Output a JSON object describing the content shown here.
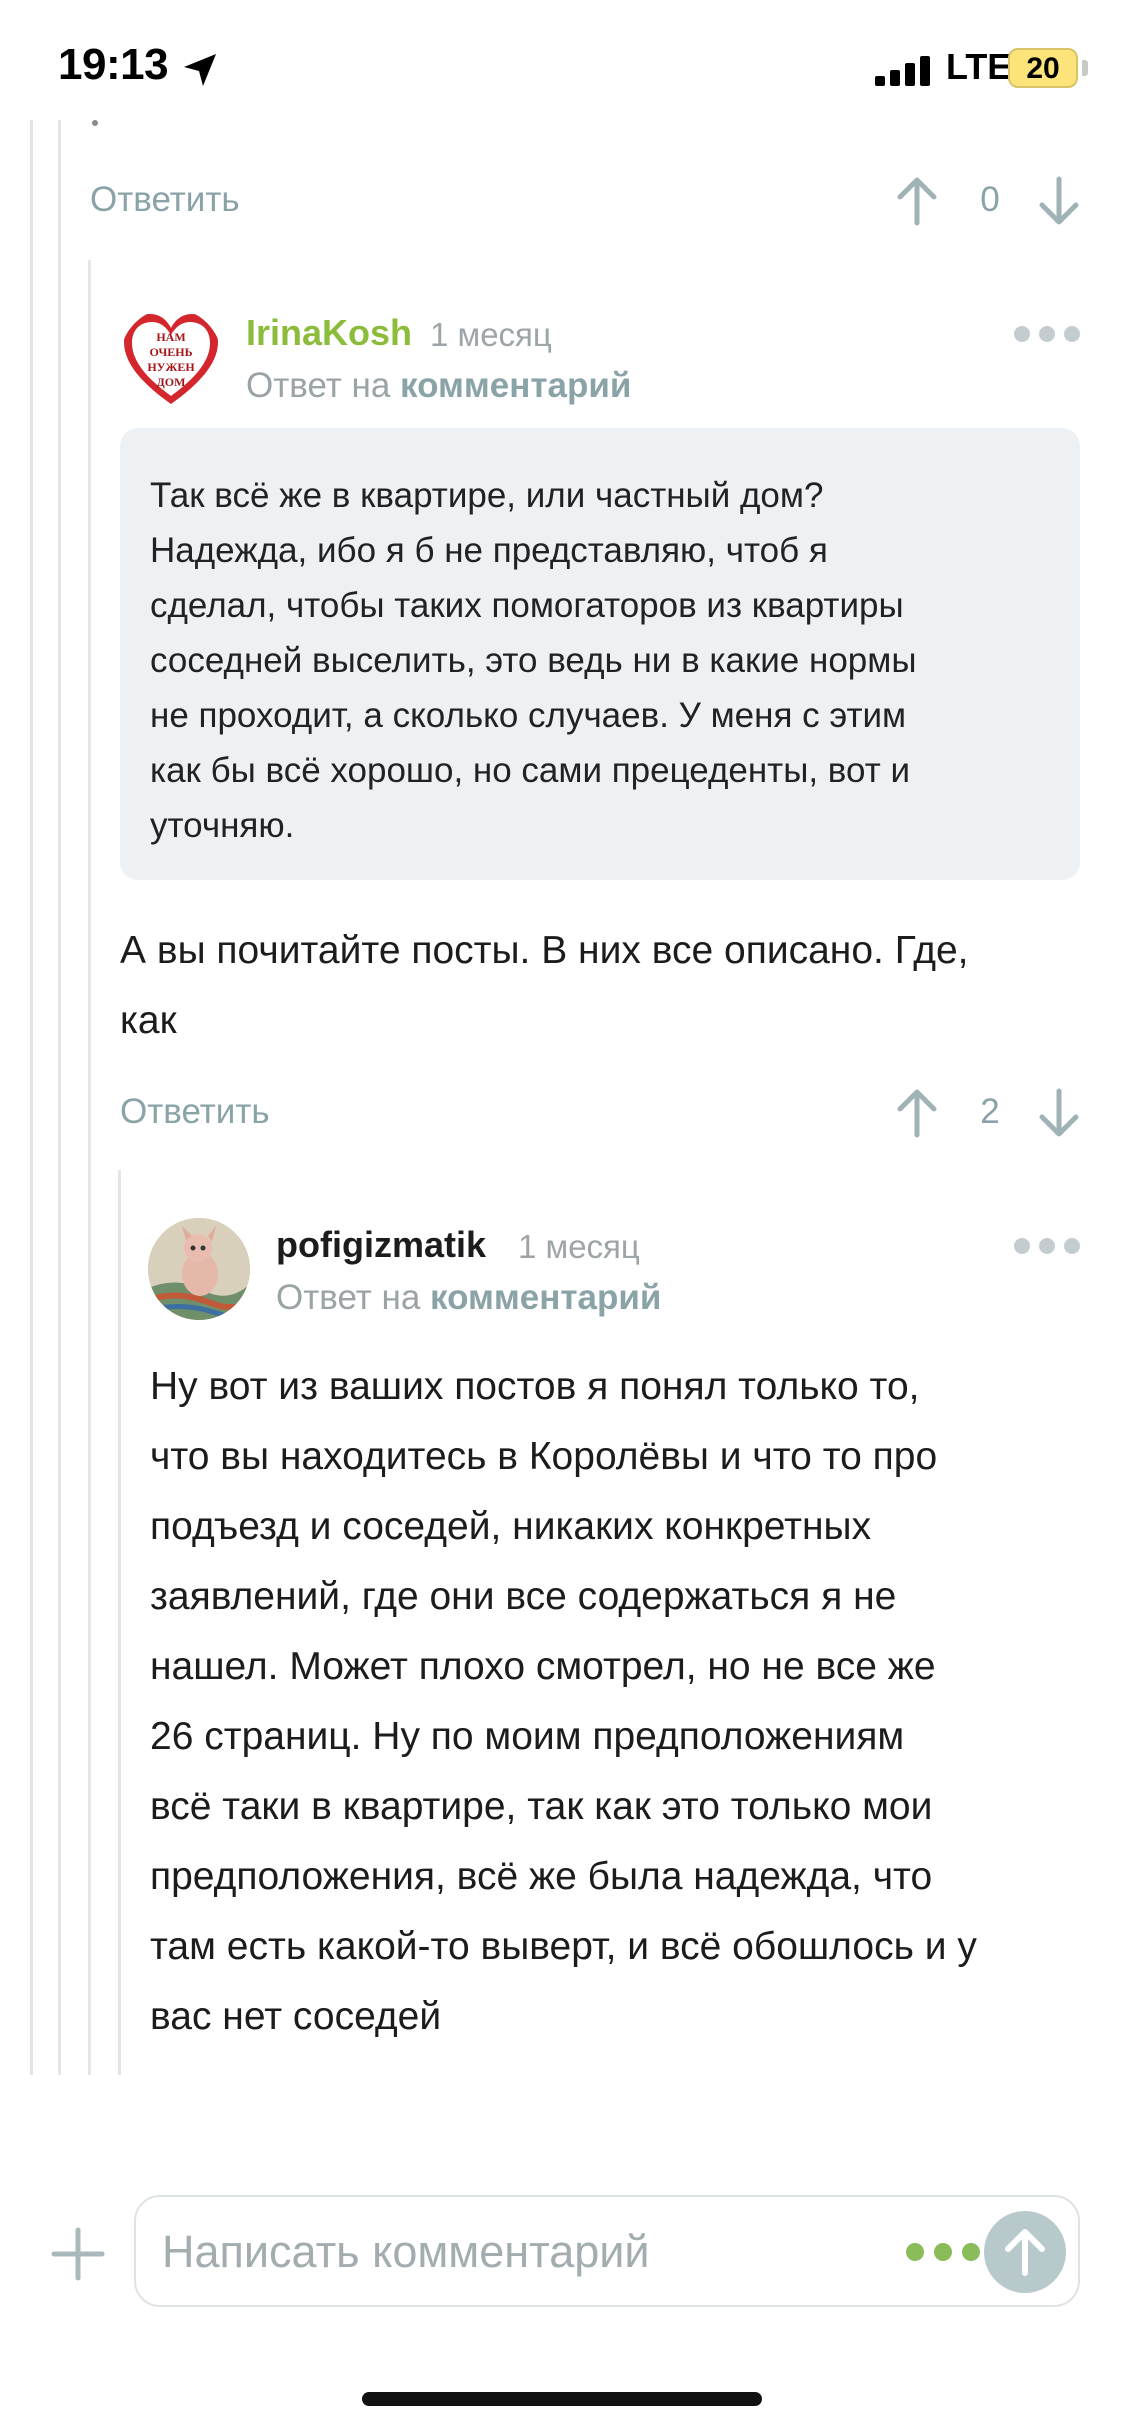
{
  "status_bar": {
    "time": "19:13",
    "network": "LTE",
    "battery": "20"
  },
  "colors": {
    "username_green": "#8bbc3c",
    "accent_gray": "#8aa3a7",
    "quote_bg": "#eef1f3"
  },
  "top_action_row": {
    "reply_label": "Ответить",
    "vote_count": "0"
  },
  "comment_1": {
    "avatar_text": [
      "НАМ",
      "ОЧЕНЬ",
      "НУЖЕН",
      "ДОМ"
    ],
    "username": "IrinaKosh",
    "time_ago": "1 месяц",
    "reply_prefix": "Ответ на",
    "reply_link": "комментарий",
    "quote_lines": [
      "Так всё же в квартире, или частный дом?",
      "Надежда, ибо я б не представляю, чтоб я",
      "сделал, чтобы таких помогаторов из квартиры",
      "соседней выселить, это ведь ни в какие нормы",
      "не проходит, а сколько случаев. У меня с этим",
      "как бы всё хорошо, но сами прецеденты, вот и",
      "уточняю."
    ],
    "body_lines": [
      "А вы почитайте посты. В них все описано. Где,",
      "как"
    ],
    "reply_label": "Ответить",
    "vote_count": "2"
  },
  "comment_2": {
    "username": "pofigizmatik",
    "time_ago": "1 месяц",
    "reply_prefix": "Ответ на",
    "reply_link": "комментарий",
    "body_lines": [
      "Ну вот из ваших постов я понял только то,",
      "что вы находитесь в Королёвы и что то про",
      "подъезд и соседей, никаких конкретных",
      "заявлений, где они все содержаться я не",
      "нашел. Может плохо смотрел, но не все же",
      "26 страниц. Ну по моим предположениям",
      "всё таки в квартире, так как это только мои",
      "предположения, всё же была надежда, что",
      "там есть какой-то выверт, и всё обошлось и у",
      "вас нет соседей"
    ]
  },
  "composer": {
    "placeholder": "Написать комментарий"
  }
}
